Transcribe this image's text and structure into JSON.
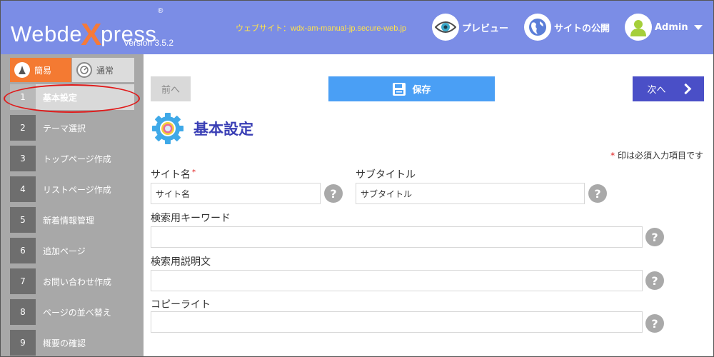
{
  "header": {
    "logo_pre": "Webde",
    "logo_x": "X",
    "logo_post": "press",
    "logo_reg": "®",
    "version": "Version 3.5.2",
    "site_url": "ウェブサイト：wdx-am-manual-jp.secure-web.jp",
    "preview_label": "プレビュー",
    "publish_label": "サイトの公開",
    "admin_label": "Admin"
  },
  "sidebar": {
    "mode_simple": "簡易",
    "mode_normal": "通常",
    "steps": [
      {
        "num": "1",
        "label": "基本設定"
      },
      {
        "num": "2",
        "label": "テーマ選択"
      },
      {
        "num": "3",
        "label": "トップページ作成"
      },
      {
        "num": "4",
        "label": "リストページ作成"
      },
      {
        "num": "5",
        "label": "新着情報管理"
      },
      {
        "num": "6",
        "label": "追加ページ"
      },
      {
        "num": "7",
        "label": "お問い合わせ作成"
      },
      {
        "num": "8",
        "label": "ページの並べ替え"
      },
      {
        "num": "9",
        "label": "概要の確認"
      }
    ]
  },
  "main": {
    "prev_label": "前へ",
    "save_label": "保存",
    "next_label": "次へ",
    "page_title": "基本設定",
    "required_star": "*",
    "required_note": "印は必須入力項目です",
    "fields": {
      "site_name_label": "サイト名",
      "site_name_value": "サイト名",
      "subtitle_label": "サブタイトル",
      "subtitle_value": "サブタイトル",
      "keywords_label": "検索用キーワード",
      "keywords_value": "",
      "description_label": "検索用説明文",
      "description_value": "",
      "copyright_label": "コピーライト",
      "copyright_value": ""
    },
    "help_glyph": "?"
  },
  "colors": {
    "header_bg": "#7b8de6",
    "accent_orange": "#f47a32",
    "save_blue": "#4a9ff5",
    "next_indigo": "#4a4fc7",
    "title_indigo": "#3a3fb5",
    "required_red": "#e01a1a"
  },
  "icons": {
    "preview": "eye-icon",
    "publish": "globe-icon",
    "admin": "user-avatar-icon",
    "save": "floppy-disk-icon",
    "next": "chevron-right-icon",
    "title": "gear-icon",
    "simple_mode": "simple-mode-icon",
    "normal_mode": "gauge-icon",
    "help": "help-icon"
  }
}
